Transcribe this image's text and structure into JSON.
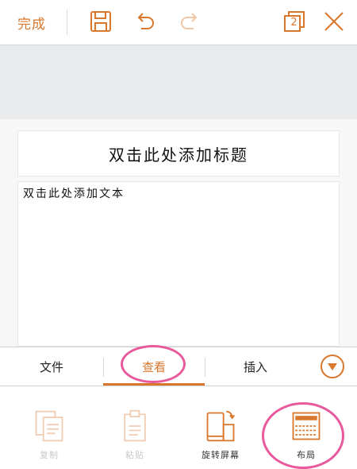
{
  "toolbar": {
    "done_label": "完成",
    "page_count": "2",
    "icons": [
      "save-icon",
      "undo-icon",
      "redo-icon",
      "pages-icon",
      "close-icon"
    ]
  },
  "slide": {
    "title_placeholder": "双击此处添加标题",
    "body_placeholder": "双击此处添加文本"
  },
  "tabs": {
    "file": "文件",
    "view": "查看",
    "insert": "插入",
    "active": "view"
  },
  "ribbon": {
    "items": [
      {
        "label": "复制",
        "icon": "copy-icon",
        "enabled": false
      },
      {
        "label": "粘贴",
        "icon": "paste-icon",
        "enabled": false
      },
      {
        "label": "旋转屏幕",
        "icon": "rotate-screen-icon",
        "enabled": true
      },
      {
        "label": "布局",
        "icon": "layout-icon",
        "enabled": true
      }
    ]
  },
  "colors": {
    "accent": "#d9772d",
    "highlight_circle": "#e85a9b",
    "gray_bar": "#e8eaec"
  }
}
